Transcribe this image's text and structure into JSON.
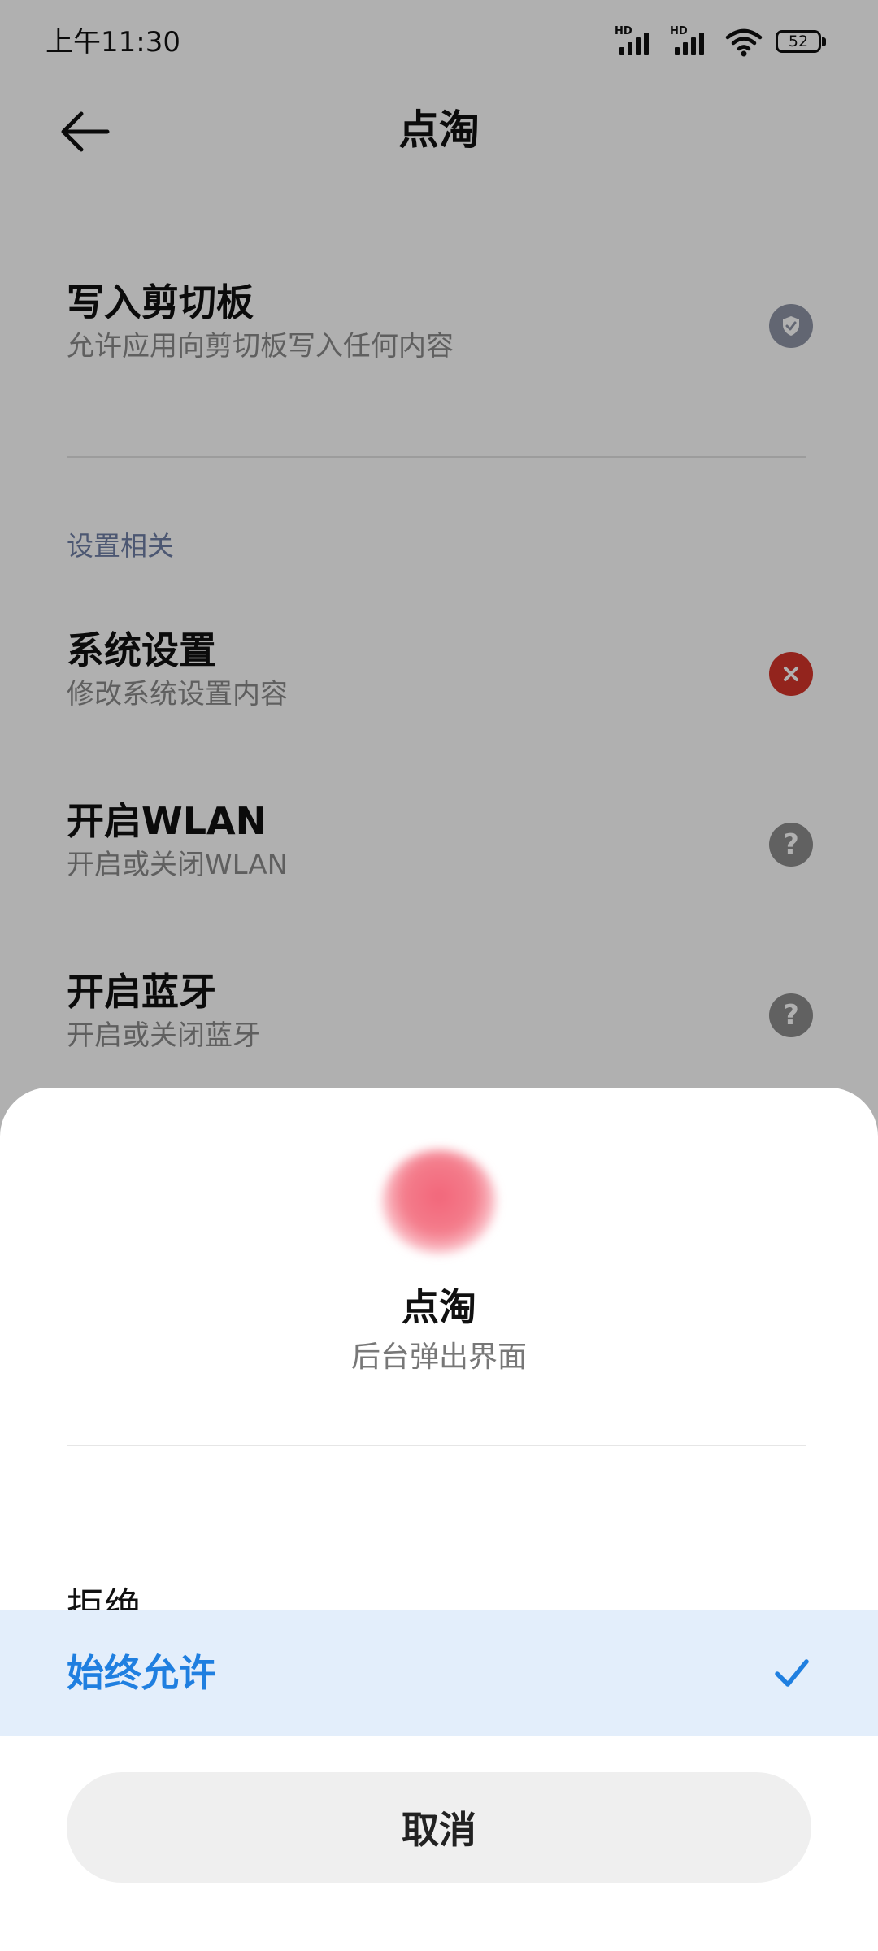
{
  "status_bar": {
    "time": "上午11:30",
    "sim1_label": "HD",
    "sim2_label": "HD",
    "battery_level": "52"
  },
  "header": {
    "back_icon": "arrow-left-icon",
    "title": "点淘"
  },
  "permissions": [
    {
      "title": "写入剪切板",
      "description": "允许应用向剪切板写入任何内容",
      "status": "allowed",
      "status_icon": "shield-check-icon",
      "status_color": "#8e94a6"
    }
  ],
  "section": {
    "label": "设置相关"
  },
  "settings_permissions": [
    {
      "title": "系统设置",
      "description": "修改系统设置内容",
      "status": "denied",
      "status_icon": "x-circle-icon",
      "status_color": "#d6352a"
    },
    {
      "title": "开启WLAN",
      "description": "开启或关闭WLAN",
      "status": "ask",
      "status_icon": "question-circle-icon",
      "status_color": "#8d8d8d"
    },
    {
      "title": "开启蓝牙",
      "description": "开启或关闭蓝牙",
      "status": "ask",
      "status_icon": "question-circle-icon",
      "status_color": "#8d8d8d"
    }
  ],
  "sheet": {
    "app_name": "点淘",
    "permission_name": "后台弹出界面",
    "options": [
      {
        "label": "拒绝",
        "selected": false
      },
      {
        "label": "始终允许",
        "selected": true
      }
    ],
    "cancel_label": "取消",
    "accent_color": "#1f7fe0"
  }
}
